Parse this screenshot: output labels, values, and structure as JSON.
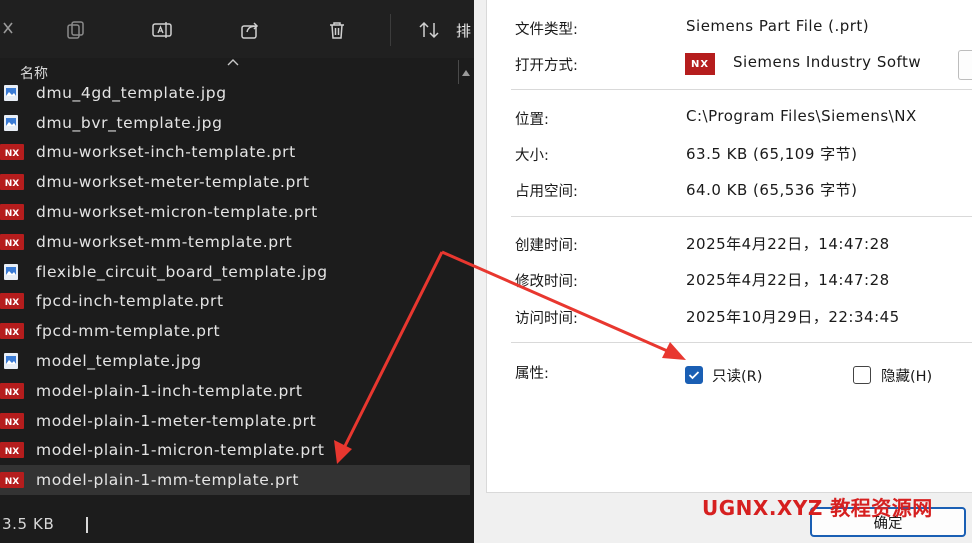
{
  "explorer": {
    "toolbar": {
      "sort_label": "排"
    },
    "column_header": {
      "name": "名称"
    },
    "files": [
      {
        "name": "dmu_4gd_template.jpg",
        "type": "jpg"
      },
      {
        "name": "dmu_bvr_template.jpg",
        "type": "jpg"
      },
      {
        "name": "dmu-workset-inch-template.prt",
        "type": "prt"
      },
      {
        "name": "dmu-workset-meter-template.prt",
        "type": "prt"
      },
      {
        "name": "dmu-workset-micron-template.prt",
        "type": "prt"
      },
      {
        "name": "dmu-workset-mm-template.prt",
        "type": "prt"
      },
      {
        "name": "flexible_circuit_board_template.jpg",
        "type": "jpg"
      },
      {
        "name": "fpcd-inch-template.prt",
        "type": "prt"
      },
      {
        "name": "fpcd-mm-template.prt",
        "type": "prt"
      },
      {
        "name": "model_template.jpg",
        "type": "jpg"
      },
      {
        "name": "model-plain-1-inch-template.prt",
        "type": "prt"
      },
      {
        "name": "model-plain-1-meter-template.prt",
        "type": "prt"
      },
      {
        "name": "model-plain-1-micron-template.prt",
        "type": "prt"
      },
      {
        "name": "model-plain-1-mm-template.prt",
        "type": "prt",
        "selected": true
      }
    ],
    "status_size": "3.5 KB"
  },
  "properties": {
    "file_type_label": "文件类型:",
    "file_type_value": "Siemens Part File (.prt)",
    "opens_with_label": "打开方式:",
    "opens_with_badge": "NX",
    "opens_with_value": "Siemens Industry Softw",
    "location_label": "位置:",
    "location_value": "C:\\Program Files\\Siemens\\NX",
    "size_label": "大小:",
    "size_value": "63.5 KB (65,109 字节)",
    "size_on_disk_label": "占用空间:",
    "size_on_disk_value": "64.0 KB (65,536 字节)",
    "created_label": "创建时间:",
    "created_value": "2025年4月22日，14:47:28",
    "modified_label": "修改时间:",
    "modified_value": "2025年4月22日，14:47:28",
    "accessed_label": "访问时间:",
    "accessed_value": "2025年10月29日，22:34:45",
    "attributes_label": "属性:",
    "readonly_label": "只读(R)",
    "readonly_checked": true,
    "hidden_label": "隐藏(H)",
    "hidden_checked": false,
    "ok_label": "确定"
  },
  "watermark": "UGNX.XYZ  教程资源网",
  "colors": {
    "accent": "#1a5fb4",
    "nx_red": "#b51d1d",
    "arrow_red": "#e8372f",
    "explorer_bg": "#1c1c1c"
  }
}
